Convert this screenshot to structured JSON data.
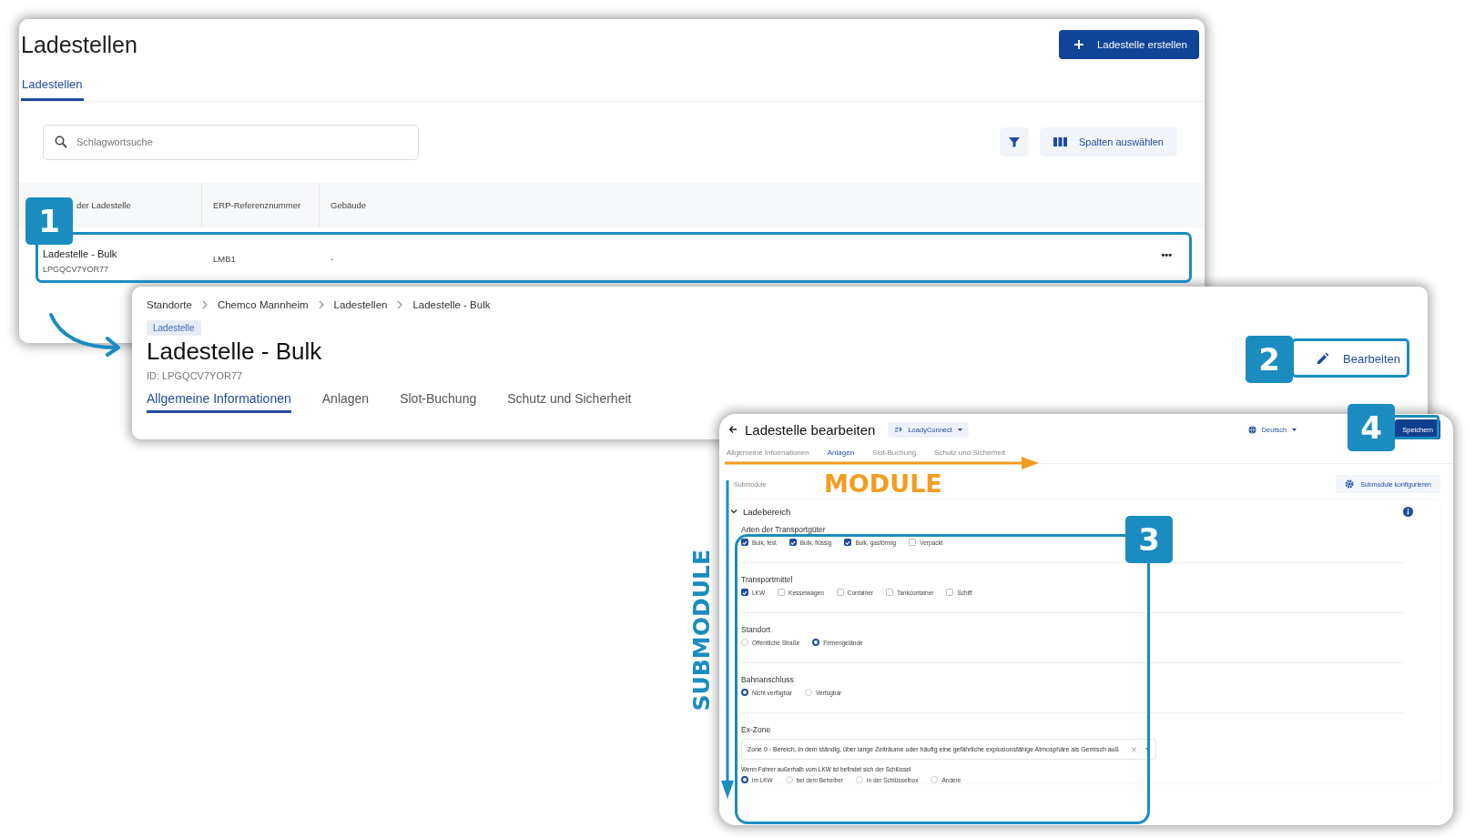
{
  "list_window": {
    "title": "Ladestellen",
    "create_button": "Ladestelle erstellen",
    "tabs": [
      {
        "label": "Ladestellen",
        "selected": true
      }
    ],
    "search": {
      "placeholder": "Schlagwortsuche"
    },
    "columns_button": "Spalten auswählen",
    "table": {
      "columns": [
        "der Ladestelle",
        "ERP-Referenznummer",
        "Gebäude"
      ],
      "rows": [
        {
          "name": "Ladestelle - Bulk",
          "id": "LPGQCV7YOR77",
          "erp": "LMB1",
          "building": "-",
          "menu": "•••"
        }
      ]
    }
  },
  "detail_window": {
    "breadcrumb": [
      "Standorte",
      "Chemco Mannheim",
      "Ladestellen",
      "Ladestelle - Bulk"
    ],
    "chip": "Ladestelle",
    "title": "Ladestelle - Bulk",
    "id": "ID: LPGQCV7YOR77",
    "edit_button": "Bearbeiten",
    "tabs": [
      {
        "label": "Allgemeine Informationen",
        "selected": true
      },
      {
        "label": "Anlagen",
        "selected": false
      },
      {
        "label": "Slot-Buchung",
        "selected": false
      },
      {
        "label": "Schutz und Sicherheit",
        "selected": false
      }
    ]
  },
  "edit_window": {
    "title": "Ladestelle bearbeiten",
    "app_chip": "LoadyConnect",
    "language": "Deutsch",
    "save_button": "Speichern",
    "tabs": [
      {
        "label": "Allgemeine Informationen",
        "selected": false
      },
      {
        "label": "Anlagen",
        "selected": true
      },
      {
        "label": "Slot-Buchung",
        "selected": false
      },
      {
        "label": "Schutz und Sicherheit",
        "selected": false
      }
    ],
    "submodule_label": "Submodule",
    "configure_button": "Submodule konfigurieren",
    "section": {
      "title": "Ladebereich",
      "expanded": true,
      "fields": [
        {
          "kind": "checkboxes",
          "label": "Arten der Transportgüter",
          "options": [
            {
              "label": "Bulk, fest",
              "checked": true
            },
            {
              "label": "Bulk, flüssig",
              "checked": true
            },
            {
              "label": "Bulk, gasförmig",
              "checked": true
            },
            {
              "label": "Verpackt",
              "checked": false
            }
          ]
        },
        {
          "kind": "checkboxes",
          "label": "Transportmittel",
          "options": [
            {
              "label": "LKW",
              "checked": true
            },
            {
              "label": "Kesselwagen",
              "checked": false
            },
            {
              "label": "Container",
              "checked": false
            },
            {
              "label": "Tankcontainer",
              "checked": false
            },
            {
              "label": "Schiff",
              "checked": false
            }
          ]
        },
        {
          "kind": "radios",
          "label": "Standort",
          "options": [
            {
              "label": "Öffentliche Straße",
              "selected": false
            },
            {
              "label": "Firmengelände",
              "selected": true
            }
          ]
        },
        {
          "kind": "radios",
          "label": "Bahnanschluss",
          "options": [
            {
              "label": "Nicht verfügbar",
              "selected": true
            },
            {
              "label": "Verfügbar",
              "selected": false
            }
          ]
        },
        {
          "kind": "select",
          "label": "Ex-Zone",
          "value": "Zone 0 - Bereich, in dem ständig, über lange Zeiträume oder häufig eine gefährliche explosionsfähige Atmosphäre als Gemisch auß"
        },
        {
          "kind": "subradios",
          "label": "Wenn Fahrer außerhalb vom LKW ist befindet sich der Schlüssel",
          "options": [
            {
              "label": "im LKW",
              "selected": true
            },
            {
              "label": "bei dem Betreiber",
              "selected": false
            },
            {
              "label": "in der Schlüsselbox",
              "selected": false
            },
            {
              "label": "Andere",
              "selected": false
            }
          ]
        }
      ]
    }
  },
  "annotations": [
    {
      "kind": "badge",
      "text": "1"
    },
    {
      "kind": "badge",
      "text": "2"
    },
    {
      "kind": "badge",
      "text": "4"
    },
    {
      "kind": "badge",
      "text": "3"
    },
    {
      "kind": "label",
      "text": "MODULE"
    },
    {
      "kind": "vertical",
      "text": "SUBMODULE"
    }
  ]
}
